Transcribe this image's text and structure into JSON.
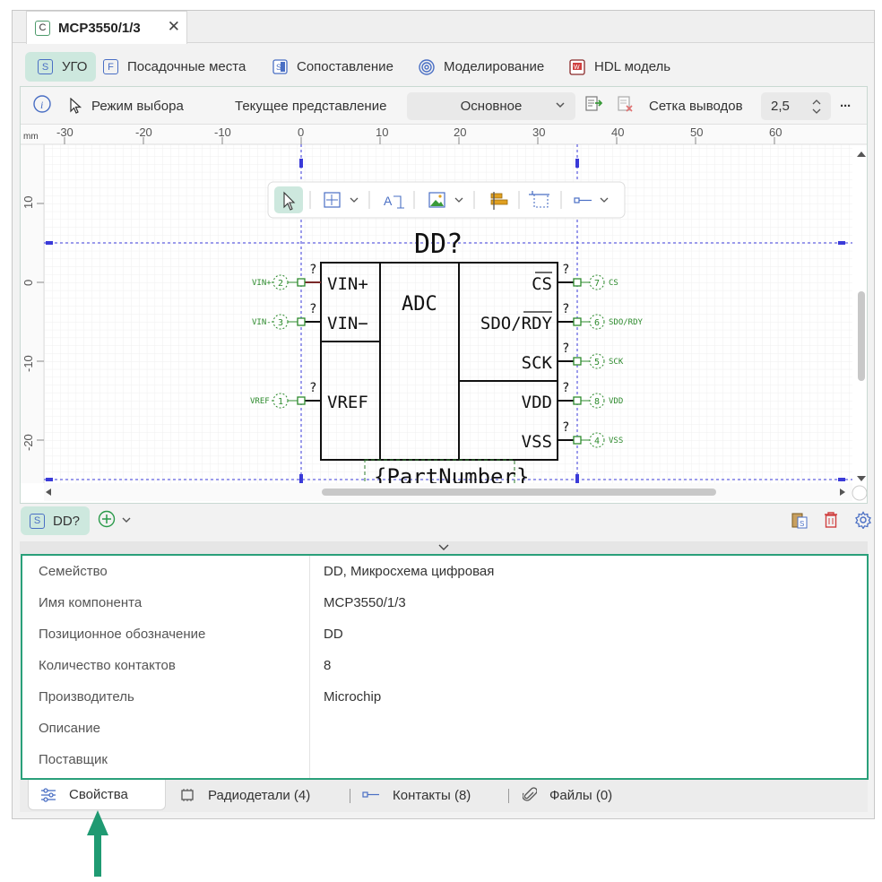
{
  "doc_tab": {
    "icon_letter": "C",
    "title": "MCP3550/1/3",
    "close": "✕"
  },
  "view_tabs": [
    {
      "icon": "S",
      "label": "УГО",
      "active": true
    },
    {
      "icon": "F",
      "label": "Посадочные места"
    },
    {
      "icon": "S",
      "label": "Сопоставление"
    },
    {
      "icon": "spiral",
      "label": "Моделирование"
    },
    {
      "icon": "hdl",
      "label": "HDL модель"
    }
  ],
  "toolbar": {
    "select_mode": "Режим выбора",
    "current_view_label": "Текущее представление",
    "current_view_value": "Основное",
    "pin_grid_label": "Сетка выводов",
    "pin_grid_value": "2,5",
    "more": "···"
  },
  "ruler": {
    "unit": "mm",
    "x_ticks": [
      "-30",
      "-20",
      "-10",
      "0",
      "10",
      "20",
      "30",
      "40",
      "50",
      "60"
    ],
    "y_ticks": [
      "10",
      "0",
      "-10",
      "-20"
    ]
  },
  "symbol": {
    "refdes": "DD?",
    "part_number": "{PartNumber}",
    "core_label": "ADC",
    "left_pins": [
      {
        "name": "VIN+",
        "num": "2",
        "net": "VIN+"
      },
      {
        "name": "VIN−",
        "num": "3",
        "net": "VIN-"
      },
      {
        "name": "VREF",
        "num": "1",
        "net": "VREF"
      }
    ],
    "right_pins": [
      {
        "name": "CS",
        "num": "7",
        "net": "CS"
      },
      {
        "name": "SDO/RDY",
        "num": "6",
        "net": "SDO/RDY"
      },
      {
        "name": "SCK",
        "num": "5",
        "net": "SCK"
      },
      {
        "name": "VDD",
        "num": "8",
        "net": "VDD"
      },
      {
        "name": "VSS",
        "num": "4",
        "net": "VSS"
      }
    ],
    "question": "?"
  },
  "component": {
    "icon": "S",
    "label": "DD?"
  },
  "properties": [
    {
      "key": "Семейство",
      "value": "DD, Микросхема цифровая"
    },
    {
      "key": "Имя компонента",
      "value": "MCP3550/1/3"
    },
    {
      "key": "Позиционное обозначение",
      "value": "DD"
    },
    {
      "key": "Количество контактов",
      "value": "8"
    },
    {
      "key": "Производитель",
      "value": "Microchip"
    },
    {
      "key": "Описание",
      "value": ""
    },
    {
      "key": "Поставщик",
      "value": ""
    }
  ],
  "bottom_tabs": [
    {
      "label": "Свойства",
      "active": true
    },
    {
      "label": "Радиодетали (4)"
    },
    {
      "label": "Контакты (8)"
    },
    {
      "label": "Файлы (0)"
    }
  ],
  "colors": {
    "accent": "#2aa07a",
    "active_tab": "#cde8de",
    "pin_green": "#2e8b2e",
    "guide_blue": "#3a3ad8"
  }
}
